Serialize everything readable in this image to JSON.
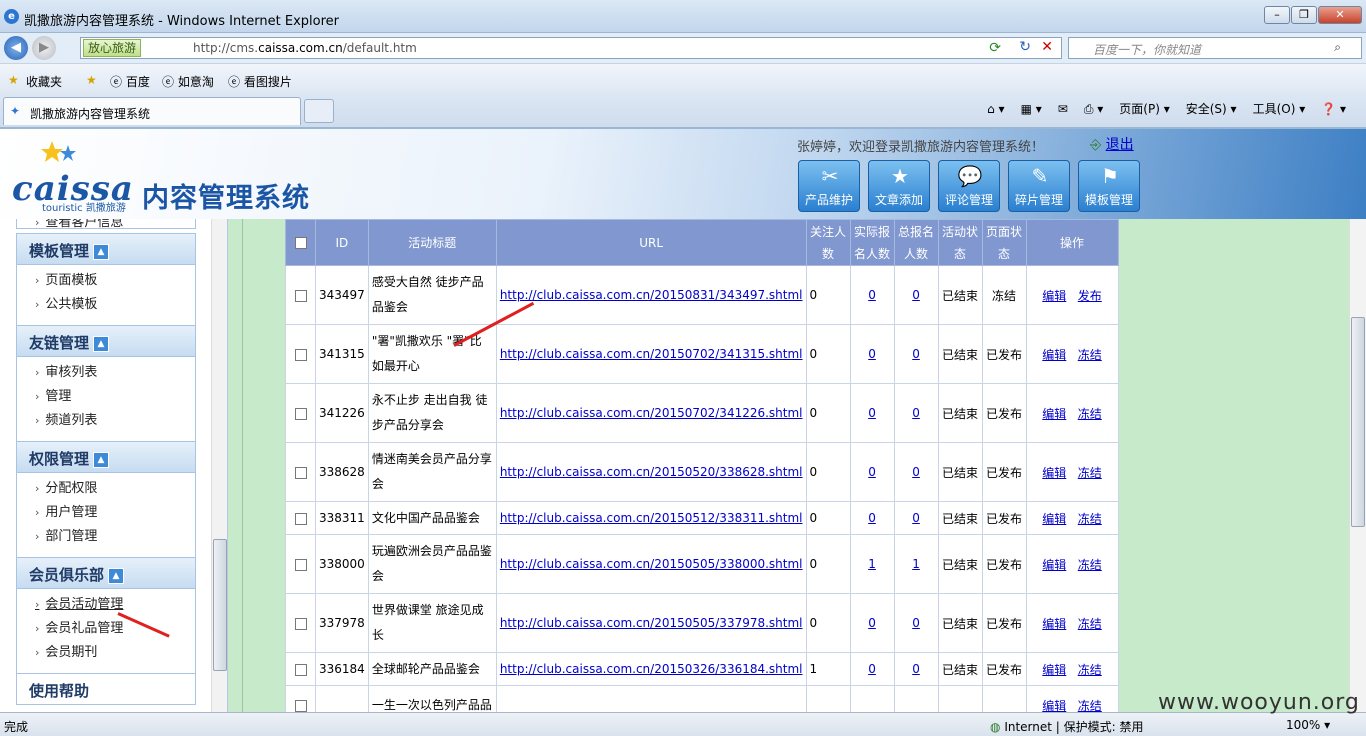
{
  "window": {
    "title": "凯撒旅游内容管理系统 - Windows Internet Explorer"
  },
  "address": {
    "tag": "放心旅游",
    "url_prefix": "http://cms.",
    "url_domain": "caissa.com.cn",
    "url_path": "/default.htm",
    "search_placeholder": "百度一下，你就知道"
  },
  "favorites": {
    "label": "收藏夹",
    "items": [
      "百度",
      "如意淘",
      "看图搜片"
    ]
  },
  "tab": {
    "label": "凯撒旅游内容管理系统"
  },
  "commands": {
    "page": "页面(P)",
    "security": "安全(S)",
    "tools": "工具(O)"
  },
  "header": {
    "logo_text": "caissa",
    "logo_sub": "touristic 凯撒旅游",
    "system_title": "内容管理系统",
    "welcome": "张婷婷，欢迎登录凯撒旅游内容管理系统！",
    "logout": "退出",
    "buttons": [
      "产品维护",
      "文章添加",
      "评论管理",
      "碎片管理",
      "模板管理"
    ]
  },
  "sidebar": {
    "partial_item": "查看客户信息",
    "sections": [
      {
        "title": "模板管理",
        "items": [
          "页面模板",
          "公共模板"
        ]
      },
      {
        "title": "友链管理",
        "items": [
          "审核列表",
          "管理",
          "频道列表"
        ]
      },
      {
        "title": "权限管理",
        "items": [
          "分配权限",
          "用户管理",
          "部门管理"
        ]
      },
      {
        "title": "会员俱乐部",
        "items": [
          "会员活动管理",
          "会员礼品管理",
          "会员期刊"
        ]
      }
    ],
    "help": "使用帮助"
  },
  "table": {
    "headers": [
      "ID",
      "活动标题",
      "URL",
      "关注人数",
      "实际报名人数",
      "总报名人数",
      "活动状态",
      "页面状态",
      "操作"
    ],
    "rows": [
      {
        "id": "343497",
        "title": "感受大自然 徒步产品品鉴会",
        "url": "http://club.caissa.com.cn/20150831/343497.shtml",
        "follow": "0",
        "actual": "0",
        "total": "0",
        "act": "已结束",
        "page": "冻结",
        "op1": "编辑",
        "op2": "发布"
      },
      {
        "id": "341315",
        "title": "\"署\"凯撒欢乐 \"署\"比如最开心",
        "url": "http://club.caissa.com.cn/20150702/341315.shtml",
        "follow": "0",
        "actual": "0",
        "total": "0",
        "act": "已结束",
        "page": "已发布",
        "op1": "编辑",
        "op2": "冻结"
      },
      {
        "id": "341226",
        "title": "永不止步 走出自我 徒步产品分享会",
        "url": "http://club.caissa.com.cn/20150702/341226.shtml",
        "follow": "0",
        "actual": "0",
        "total": "0",
        "act": "已结束",
        "page": "已发布",
        "op1": "编辑",
        "op2": "冻结"
      },
      {
        "id": "338628",
        "title": "情迷南美会员产品分享会",
        "url": "http://club.caissa.com.cn/20150520/338628.shtml",
        "follow": "0",
        "actual": "0",
        "total": "0",
        "act": "已结束",
        "page": "已发布",
        "op1": "编辑",
        "op2": "冻结"
      },
      {
        "id": "338311",
        "title": "文化中国产品品鉴会",
        "url": "http://club.caissa.com.cn/20150512/338311.shtml",
        "follow": "0",
        "actual": "0",
        "total": "0",
        "act": "已结束",
        "page": "已发布",
        "op1": "编辑",
        "op2": "冻结"
      },
      {
        "id": "338000",
        "title": "玩遍欧洲会员产品品鉴会",
        "url": "http://club.caissa.com.cn/20150505/338000.shtml",
        "follow": "0",
        "actual": "1",
        "total": "1",
        "act": "已结束",
        "page": "已发布",
        "op1": "编辑",
        "op2": "冻结"
      },
      {
        "id": "337978",
        "title": "世界做课堂 旅途见成长",
        "url": "http://club.caissa.com.cn/20150505/337978.shtml",
        "follow": "0",
        "actual": "0",
        "total": "0",
        "act": "已结束",
        "page": "已发布",
        "op1": "编辑",
        "op2": "冻结"
      },
      {
        "id": "336184",
        "title": "全球邮轮产品品鉴会",
        "url": "http://club.caissa.com.cn/20150326/336184.shtml",
        "follow": "1",
        "actual": "0",
        "total": "0",
        "act": "已结束",
        "page": "已发布",
        "op1": "编辑",
        "op2": "冻结"
      },
      {
        "id": "",
        "title": "一生一次以色列产品品",
        "url": "",
        "follow": "",
        "actual": "",
        "total": "",
        "act": "",
        "page": "",
        "op1": "编辑",
        "op2": "冻结"
      }
    ]
  },
  "status": {
    "done": "完成",
    "zone": "Internet | 保护模式: 禁用",
    "zoom": "100%"
  },
  "watermark": "www.wooyun.org",
  "colors": {
    "table_header": "#8197cf",
    "content_bg": "#c7eacb",
    "arrow": "#e02020"
  }
}
